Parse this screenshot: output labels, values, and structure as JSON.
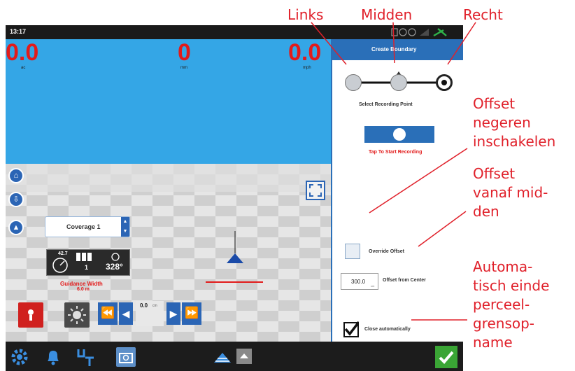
{
  "callouts": {
    "links": "Links",
    "midden": "Midden",
    "recht": "Recht",
    "offset_negeren": [
      "Offset",
      "negeren",
      "inschakelen"
    ],
    "offset_midden": [
      "Offset",
      "vanaf mid-",
      "den"
    ],
    "automatisch": [
      "Automa-",
      "tisch einde",
      "perceel-",
      "grensop-",
      "name"
    ]
  },
  "statusbar": {
    "time": "13:17"
  },
  "readouts": [
    {
      "value": "0.0",
      "unit": "ac"
    },
    {
      "value": "0",
      "unit": "mm"
    },
    {
      "value": "0.0",
      "unit": "mph"
    }
  ],
  "coverage": {
    "label": "Coverage 1"
  },
  "gauges": {
    "speed_value": "42.7",
    "sections_value": "1",
    "heading_value": "328°"
  },
  "guidance": {
    "label": "Guidance Width",
    "value": "6.0 m"
  },
  "nudge": {
    "value": "0.0",
    "unit": "cm"
  },
  "panel": {
    "title": "Create Boundary",
    "select_label": "Select Recording Point",
    "tap_label": "Tap To Start Recording",
    "override_label": "Override Offset",
    "offset_value": "300.0",
    "offset_unit": "cm",
    "offset_label": "Offset from Center",
    "close_label": "Close automatically"
  },
  "colors": {
    "sky": "#34a6e6",
    "accent_blue": "#2b65b5",
    "readout_red": "#e21b1b",
    "callout_red": "#e0202a",
    "confirm_green": "#3aa535"
  },
  "icons": [
    "settings-gear-icon",
    "bell-icon",
    "ut-icon",
    "camera-icon",
    "guidance-lines-icon",
    "chevron-up-icon",
    "checkmark-icon"
  ]
}
